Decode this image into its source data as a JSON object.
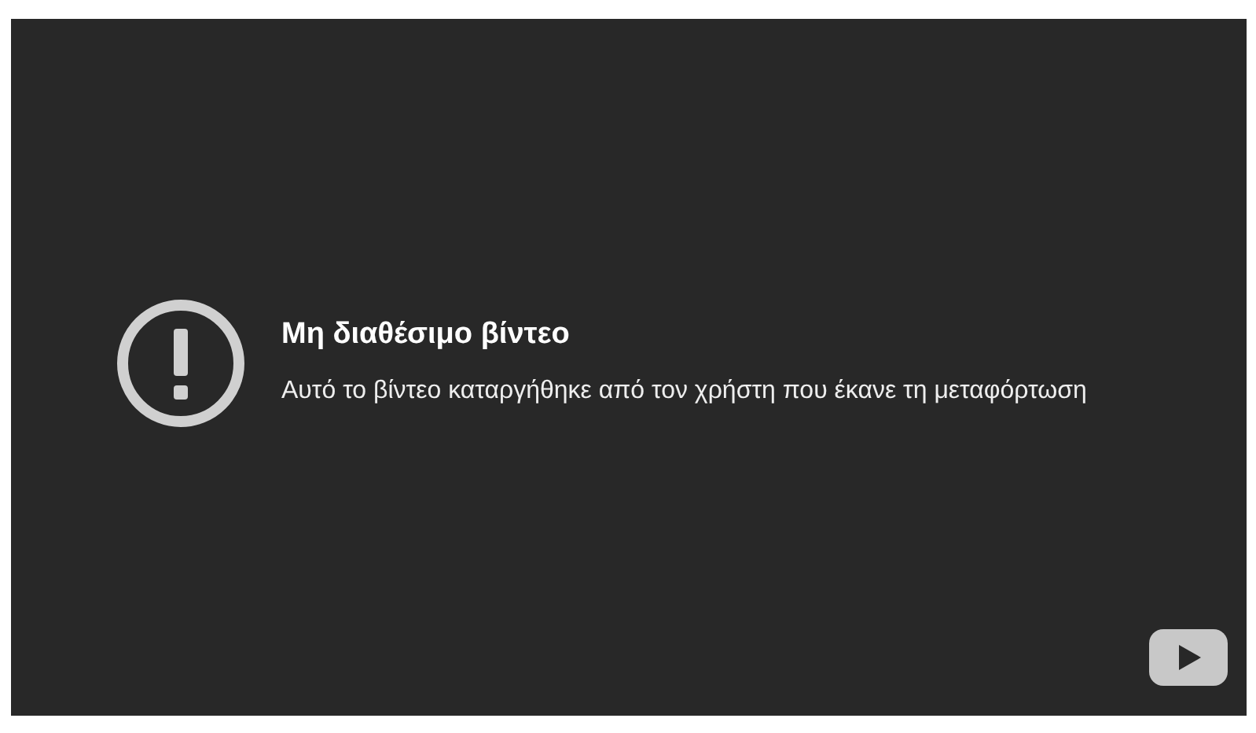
{
  "player": {
    "title": "Μη διαθέσιμο βίντεο",
    "message": "Αυτό το βίντεο καταργήθηκε από τον χρήστη που έκανε τη μεταφόρτωση"
  }
}
